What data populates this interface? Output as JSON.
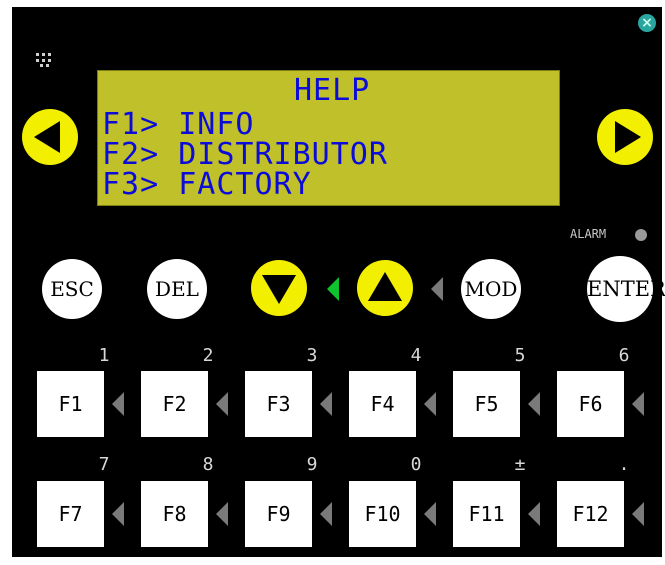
{
  "icons": {
    "close": "close-icon",
    "network": "network-icon",
    "left": "left-arrow-icon",
    "right": "right-arrow-icon",
    "down": "down-arrow-icon",
    "up": "up-arrow-icon"
  },
  "colors": {
    "panel": "#000000",
    "lcd_background": "#bfc02a",
    "lcd_text": "#0c0cd8",
    "arrow_yellow": "#f2ef00",
    "indicator_active": "#10c22b",
    "indicator_idle": "#7a7a7a",
    "alarm_led": "#9a9a9a"
  },
  "lcd": {
    "title": "HELP",
    "lines": [
      "F1> INFO",
      "F2> DISTRIBUTOR",
      "F3> FACTORY"
    ]
  },
  "alarm": {
    "label": "ALARM"
  },
  "buttons": {
    "esc": "ESC",
    "del": "DEL",
    "mod": "MOD",
    "enter": "ENTER"
  },
  "function_keys": [
    {
      "label": "F1",
      "number": "1"
    },
    {
      "label": "F2",
      "number": "2"
    },
    {
      "label": "F3",
      "number": "3"
    },
    {
      "label": "F4",
      "number": "4"
    },
    {
      "label": "F5",
      "number": "5"
    },
    {
      "label": "F6",
      "number": "6"
    },
    {
      "label": "F7",
      "number": "7"
    },
    {
      "label": "F8",
      "number": "8"
    },
    {
      "label": "F9",
      "number": "9"
    },
    {
      "label": "F10",
      "number": "0"
    },
    {
      "label": "F11",
      "number": "±"
    },
    {
      "label": "F12",
      "number": "."
    }
  ]
}
